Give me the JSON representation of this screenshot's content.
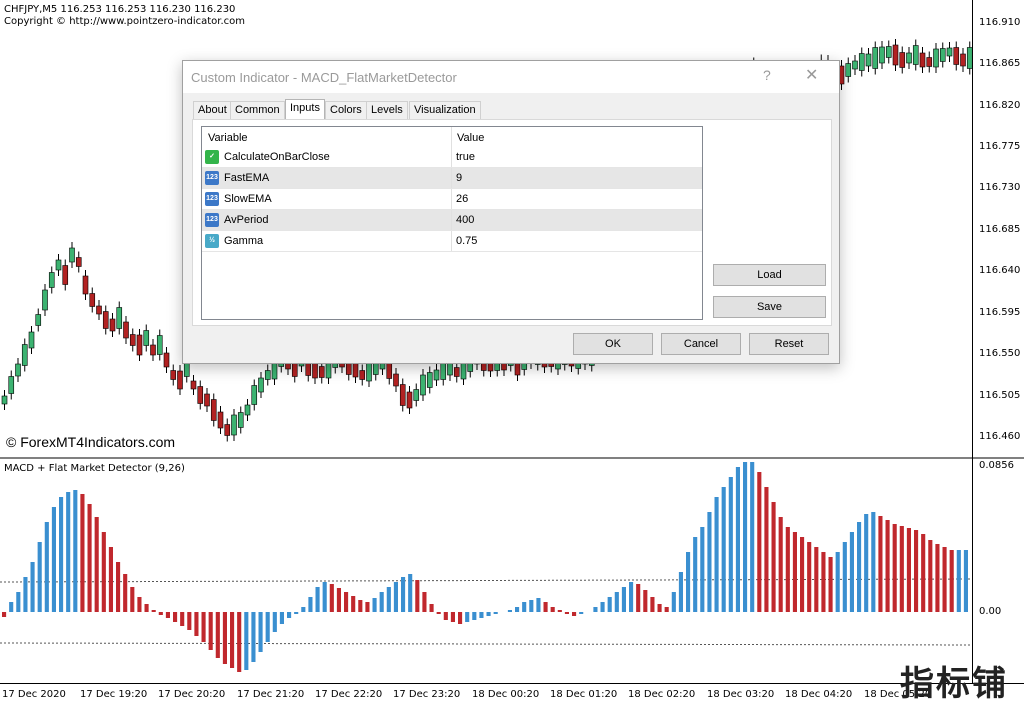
{
  "chart": {
    "symbol_line": "CHFJPY,M5  116.253 116.253 116.230 116.230",
    "copyright_line": "Copyright © http://www.pointzero-indicator.com",
    "watermark_site": "© ForexMT4Indicators.com",
    "indicator_title": "MACD + Flat Market Detector (9,26)",
    "corner_watermark": "指标铺"
  },
  "price_axis": [
    "116.910",
    "116.865",
    "116.820",
    "116.775",
    "116.730",
    "116.685",
    "116.640",
    "116.595",
    "116.550",
    "116.505",
    "116.460"
  ],
  "indicator_axis": [
    "0.0856",
    "0.00"
  ],
  "time_axis": [
    "17 Dec 2020",
    "17 Dec 19:20",
    "17 Dec 20:20",
    "17 Dec 21:20",
    "17 Dec 22:20",
    "17 Dec 23:20",
    "18 Dec 00:20",
    "18 Dec 01:20",
    "18 Dec 02:20",
    "18 Dec 03:20",
    "18 Dec 04:20",
    "18 Dec 05:20"
  ],
  "colors": {
    "bull": "#3cb371",
    "bear": "#b22222",
    "hist_up": "#3a8fd0",
    "hist_down": "#c0282d"
  },
  "dialog": {
    "title": "Custom Indicator - MACD_FlatMarketDetector",
    "help_glyph": "?",
    "close_glyph": "✕",
    "tabs": [
      "About",
      "Common",
      "Inputs",
      "Colors",
      "Levels",
      "Visualization"
    ],
    "active_tab": "Inputs",
    "grid_headers": {
      "variable": "Variable",
      "value": "Value"
    },
    "inputs": [
      {
        "name": "CalculateOnBarClose",
        "value": "true",
        "icon": "bool-icon"
      },
      {
        "name": "FastEMA",
        "value": "9",
        "icon": "int-icon"
      },
      {
        "name": "SlowEMA",
        "value": "26",
        "icon": "int-icon"
      },
      {
        "name": "AvPeriod",
        "value": "400",
        "icon": "int-icon"
      },
      {
        "name": "Gamma",
        "value": "0.75",
        "icon": "double-icon"
      }
    ],
    "buttons": {
      "load": "Load",
      "save": "Save",
      "ok": "OK",
      "cancel": "Cancel",
      "reset": "Reset"
    }
  }
}
